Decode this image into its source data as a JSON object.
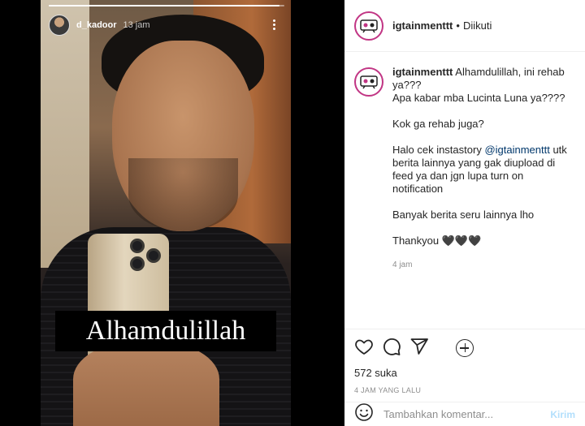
{
  "story": {
    "username": "d_kadoor",
    "time": "13 jam",
    "progress": 0.98,
    "overlay_text": "Alhamdulillah"
  },
  "post": {
    "account": "igtainmenttt",
    "separator": "•",
    "follow_status": "Diikuti",
    "caption_lines": [
      "Alhamdulillah, ini rehab ya???",
      "Apa kabar mba Lucinta Luna ya????",
      "",
      "Kok ga rehab juga?",
      "",
      "Halo cek instastory ",
      "@igtainmenttt",
      " utk berita lainnya yang gak diupload di feed ya dan jgn lupa turn on notification",
      "",
      "Banyak berita seru lainnya lho",
      "",
      "Thankyou ",
      "🖤🖤🖤"
    ],
    "comment_time": "4 jam",
    "likes": "572 suka",
    "posted_ago": "4 JAM YANG LALU"
  },
  "comment_box": {
    "placeholder": "Tambahkan komentar...",
    "post_label": "Kirim"
  },
  "icons": [
    "heart-icon",
    "comment-icon",
    "share-icon",
    "emoji-icon",
    "more-icon",
    "load-more-icon"
  ]
}
